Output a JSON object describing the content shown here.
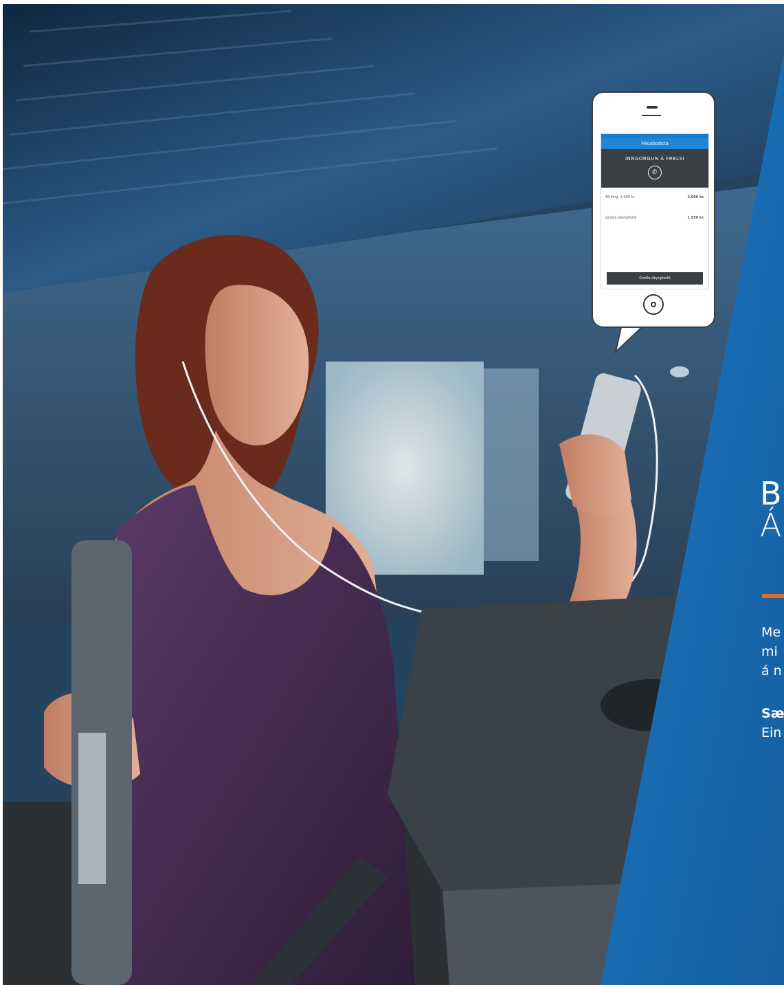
{
  "photo": {
    "subject": "woman on elliptical trainer holding smartphone",
    "colors": {
      "ceiling": "#1b3550",
      "wall": "#4c6f8f",
      "top": "#2e5a85",
      "window": "#d9e6ec",
      "tank_top": "#4b2f55",
      "skin": "#d49a80",
      "hair": "#6a2a1c",
      "machine": "#3a4148",
      "floor": "#2b3035"
    }
  },
  "phone": {
    "screen_title": "Fékaboðsta",
    "banner": "INNGORGUN Á FRELSI",
    "row1_label": "Áfylling, 2.000 kr.",
    "row1_value": "2.000 kr.",
    "row2_label": "Greiða ábyrgðarfé",
    "row2_value": "1.950 kr.",
    "button": "Greiða ábyrgðarfé",
    "icon_call": "phone-icon",
    "icon_home": "home-button-icon"
  },
  "panel": {
    "heading_line1": "B",
    "heading_line2": "Á",
    "body_line1": "Me",
    "body_line2": "mi",
    "body_line3": "á n",
    "bold_line": "Sæ",
    "last_line": "Ein",
    "accent": "#e36b2a",
    "bg": "#1a6fba"
  }
}
